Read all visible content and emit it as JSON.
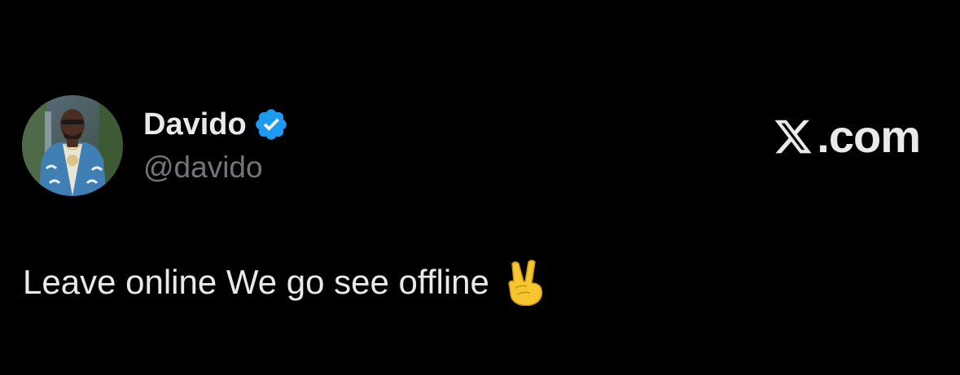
{
  "author": {
    "display_name": "Davido",
    "handle": "@davido",
    "verified_icon": "verified-badge-icon",
    "avatar_icon": "profile-photo"
  },
  "brand": {
    "logo_icon": "x-logo-icon",
    "text": ".com"
  },
  "tweet": {
    "text": "Leave online We go see offline",
    "emoji": "victory-hand-emoji"
  },
  "colors": {
    "background": "#000000",
    "primary_text": "#e7e9ea",
    "secondary_text": "#71767b",
    "verified_blue": "#1d9bf0"
  }
}
